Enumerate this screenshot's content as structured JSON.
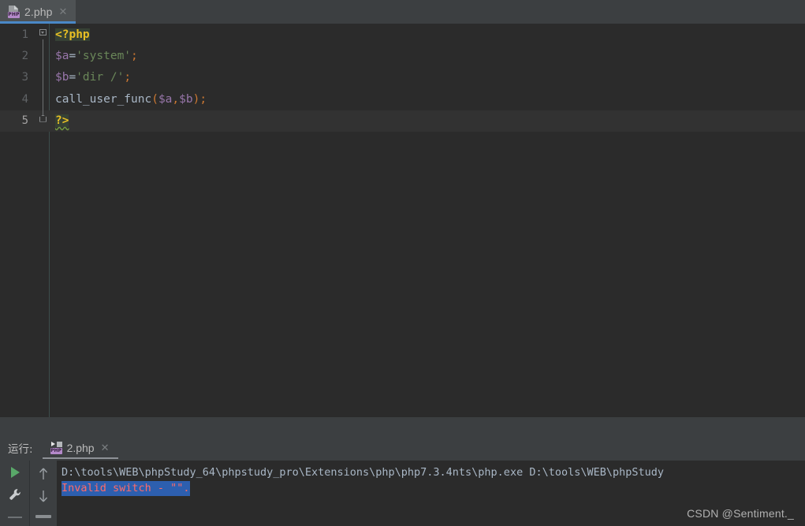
{
  "editor_tab": {
    "icon": "php-file-icon",
    "icon_badge": "PHP",
    "label": "2.php",
    "close_icon": "✕"
  },
  "editor": {
    "lines": [
      {
        "number": "1",
        "text": "<?php"
      },
      {
        "number": "2",
        "text": "$a='system';"
      },
      {
        "number": "3",
        "text": "$b='dir /';"
      },
      {
        "number": "4",
        "text": "call_user_func($a,$b);"
      },
      {
        "number": "5",
        "text": "?>"
      }
    ],
    "tokens": {
      "l1_phptag": "<?php",
      "l2_var": "$a",
      "l2_eq": "=",
      "l2_str": "'system'",
      "l2_semi": ";",
      "l3_var": "$b",
      "l3_eq": "=",
      "l3_str": "'dir /'",
      "l3_semi": ";",
      "l4_func": "call_user_func",
      "l4_open": "(",
      "l4_arg1": "$a",
      "l4_comma": ",",
      "l4_arg2": "$b",
      "l4_close": ")",
      "l4_semi": ";",
      "l5_phpclose": "?>"
    },
    "caret_line": "5"
  },
  "run_window": {
    "title": "运行:",
    "tab": {
      "icon": "run-config-icon",
      "icon_badge": "PHP",
      "label": "2.php",
      "close_icon": "✕"
    },
    "toolbar": {
      "rerun_label": "Rerun",
      "settings_label": "Settings",
      "up_label": "Previous occurrence",
      "down_label": "Next occurrence"
    },
    "console": {
      "command_line": "D:\\tools\\WEB\\phpStudy_64\\phpstudy_pro\\Extensions\\php\\php7.3.4nts\\php.exe D:\\tools\\WEB\\phpStudy",
      "error_line": "Invalid switch - \"\"."
    }
  },
  "watermark": "CSDN @Sentiment._",
  "colors": {
    "ide_chrome": "#3c3f41",
    "editor_bg": "#2b2b2b",
    "tab_active_bg": "#4e5254",
    "tab_underline": "#4a88c7",
    "caret_line_bg": "#323232",
    "php_tag": "#e8bf24",
    "php_tag_bg": "#364135",
    "variable": "#9876aa",
    "string": "#6a8759",
    "punctuation": "#cc7832",
    "default_text": "#a9b7c6",
    "error_text": "#ff6b68",
    "selection_bg": "#2d5faf",
    "play_green": "#59a869",
    "php_badge": "#b489c9"
  }
}
